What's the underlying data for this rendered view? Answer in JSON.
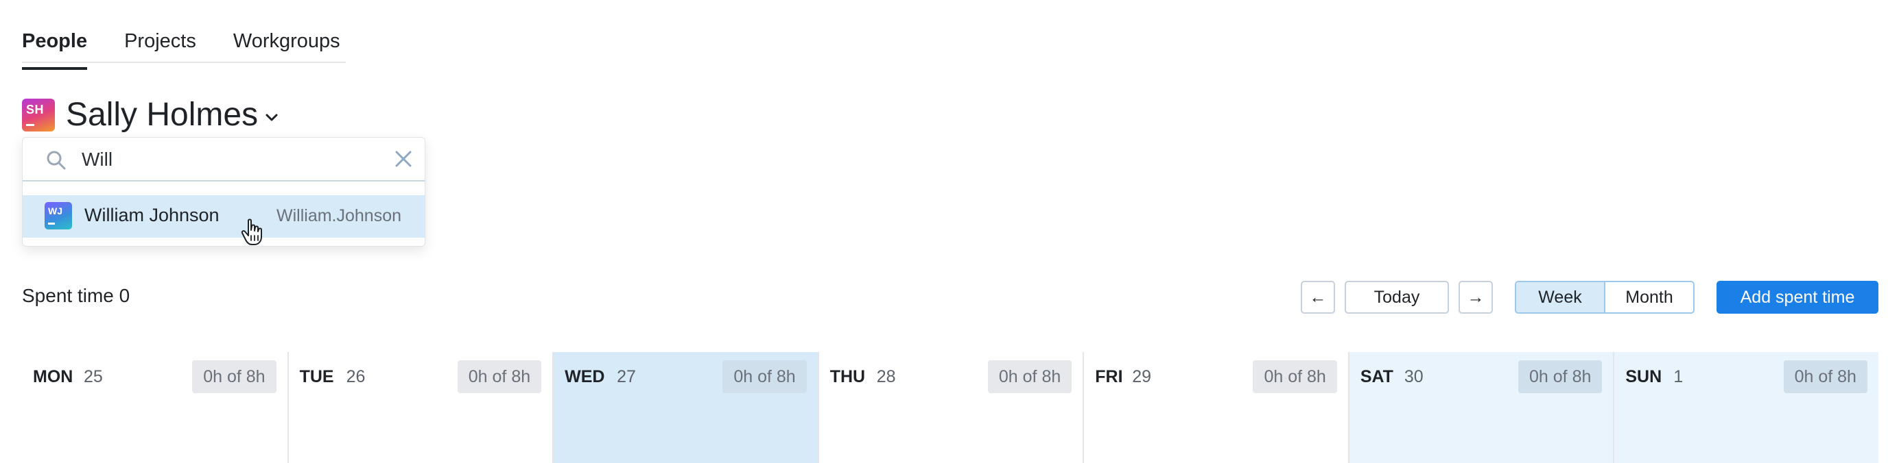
{
  "tabs": [
    {
      "label": "People",
      "active": true
    },
    {
      "label": "Projects",
      "active": false
    },
    {
      "label": "Workgroups",
      "active": false
    }
  ],
  "person": {
    "initials": "SH",
    "name": "Sally Holmes"
  },
  "dropdown": {
    "search_value": "Will",
    "results": [
      {
        "initials": "WJ",
        "name": "William Johnson",
        "login": "William.Johnson"
      }
    ]
  },
  "summary": {
    "spent_time": "Spent time 0"
  },
  "toolbar": {
    "prev": "←",
    "today": "Today",
    "next": "→",
    "week": "Week",
    "month": "Month",
    "add": "Add spent time",
    "active_view": "Week"
  },
  "days": [
    {
      "name": "MON",
      "num": "25",
      "hours": "0h of 8h"
    },
    {
      "name": "TUE",
      "num": "26",
      "hours": "0h of 8h"
    },
    {
      "name": "WED",
      "num": "27",
      "hours": "0h of 8h"
    },
    {
      "name": "THU",
      "num": "28",
      "hours": "0h of 8h"
    },
    {
      "name": "FRI",
      "num": "29",
      "hours": "0h of 8h"
    },
    {
      "name": "SAT",
      "num": "30",
      "hours": "0h of 8h"
    },
    {
      "name": "SUN",
      "num": "1",
      "hours": "0h of 8h"
    }
  ],
  "colors": {
    "accent": "#1a7fe6",
    "today_bg": "#d6eaf8",
    "weekend_bg": "#eaf4fc"
  }
}
